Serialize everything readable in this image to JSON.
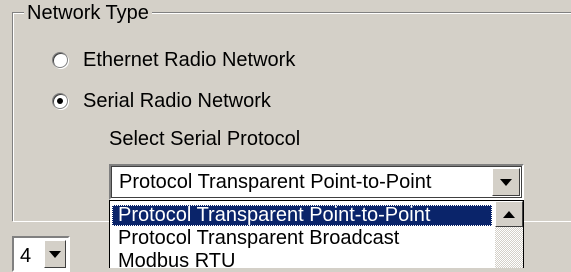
{
  "network_type": {
    "group_label": "Network Type",
    "options": [
      {
        "label": "Ethernet Radio Network",
        "selected": false
      },
      {
        "label": "Serial Radio Network",
        "selected": true
      }
    ]
  },
  "serial_protocol": {
    "label": "Select Serial Protocol",
    "value": "Protocol Transparent Point-to-Point",
    "dropdown_options": [
      "Protocol Transparent Point-to-Point",
      "Protocol Transparent Broadcast",
      "Modbus RTU"
    ],
    "highlighted_index": 0
  },
  "small_select": {
    "value": "4"
  },
  "icons": {
    "dropdown_arrow": "chevron-down-icon",
    "scroll_up": "scroll-up-arrow-icon"
  },
  "colors": {
    "window_bg": "#d4d0c8",
    "selection_bg": "#0a246a",
    "selection_text": "#ffffff"
  }
}
